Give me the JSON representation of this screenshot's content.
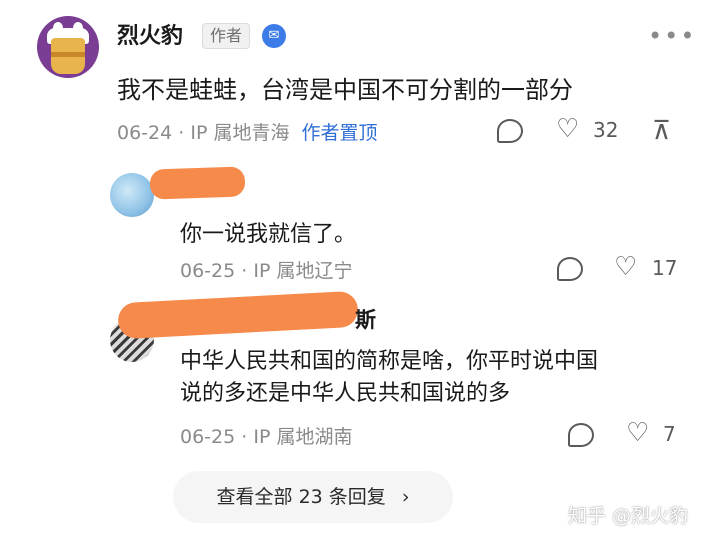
{
  "main_comment": {
    "username": "烈火豹",
    "author_tag": "作者",
    "content": "我不是蛙蛙，台湾是中国不可分割的一部分",
    "date": "06-24",
    "location": "IP 属地青海",
    "pinned_label": "作者置顶",
    "like_count": "32"
  },
  "replies": [
    {
      "content": "你一说我就信了。",
      "date": "06-25",
      "location": "IP 属地辽宁",
      "like_count": "17"
    },
    {
      "name_visible": "斯",
      "content_line1": "中华人民共和国的简称是啥，你平时说中国",
      "content_line2": "说的多还是中华人民共和国说的多",
      "date": "06-25",
      "location": "IP 属地湖南",
      "like_count": "7"
    }
  ],
  "view_all": {
    "label": "查看全部 23 条回复",
    "arrow": "›"
  },
  "watermark": "知乎 @烈火豹",
  "icons": {
    "more": "more-dots-icon",
    "reply": "comment-bubble-icon",
    "like": "heart-icon",
    "pin": "pin-top-icon",
    "verify": "verified-badge-icon"
  },
  "colors": {
    "accent_blue": "#2f6fd6",
    "redaction": "#f58a4b",
    "meta_gray": "#8a8a8a"
  }
}
